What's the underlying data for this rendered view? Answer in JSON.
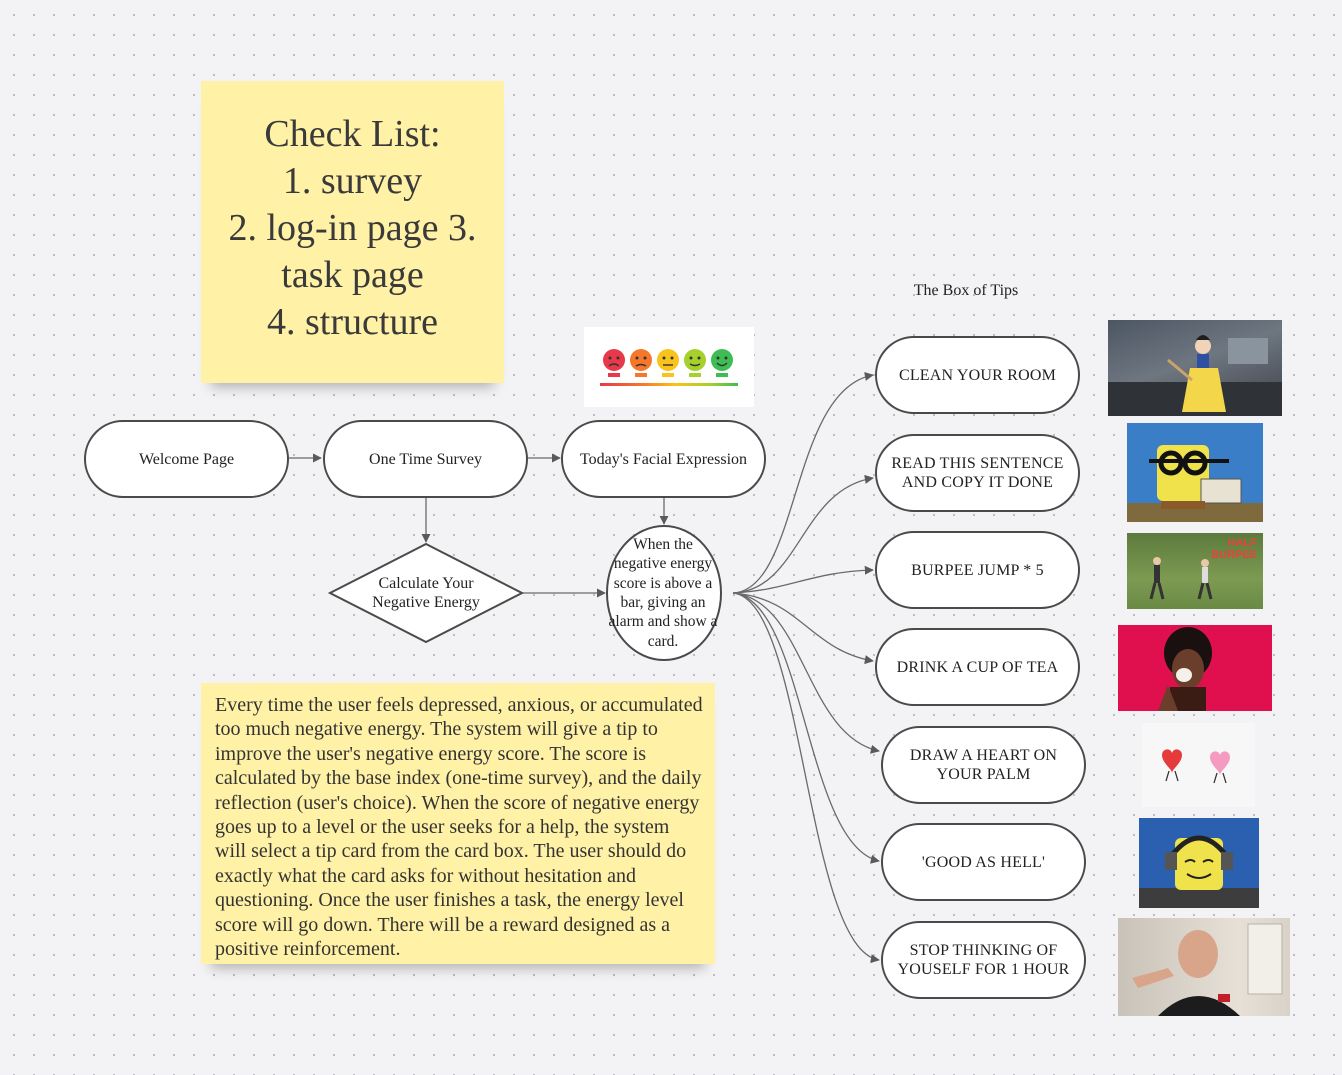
{
  "checklist": {
    "text": "Check List:\n1. survey\n2. log-in page  3.\ntask page\n4. structure"
  },
  "description": {
    "text": "Every time the user feels depressed, anxious, or accumulated too much negative energy. The system will give a tip to improve the user's negative energy score.  The score is calculated by the base index (one-time survey), and the daily reflection (user's choice). When the score of negative energy goes up to a level or the user seeks for a help, the system will select a tip card from the card box. The user should do exactly what the card asks for without hesitation and questioning. Once the user finishes a task, the energy level score will go down. There will be a reward designed as a positive reinforcement."
  },
  "flow": {
    "welcome": "Welcome Page",
    "survey": "One Time Survey",
    "facial": "Today's Facial Expression",
    "calculate": "Calculate Your Negative Energy",
    "alarm": "When the negative energy score is above a bar, giving an alarm and show a card."
  },
  "tips": {
    "title": "The Box of Tips",
    "items": [
      "CLEAN YOUR ROOM",
      "READ THIS SENTENCE AND COPY IT DONE",
      "BURPEE JUMP * 5",
      "DRINK A CUP OF TEA",
      "DRAW A HEART ON YOUR PALM",
      "'GOOD AS HELL'",
      "STOP THINKING OF YOUSELF FOR 1 HOUR"
    ]
  },
  "images": {
    "burpee_caption": "HALF BURPEE"
  },
  "colors": {
    "sticky": "#fff1a6",
    "stroke": "#4a4a4a",
    "canvas": "#f3f3f5"
  }
}
